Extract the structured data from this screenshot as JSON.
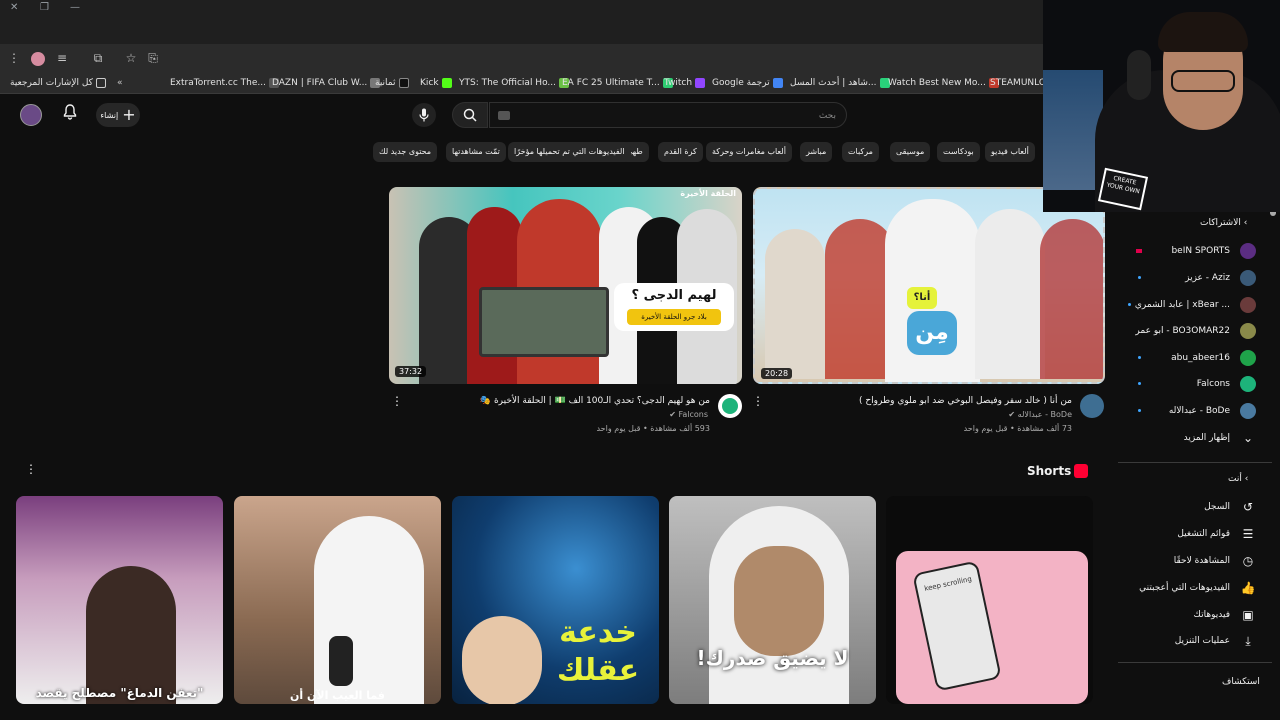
{
  "browser": {
    "bookmarks": [
      {
        "label": "كل الإشارات المرجعية",
        "icon": "folder-icon"
      },
      {
        "label": "ExtraTorrent.cc The...",
        "icon": "site-icon"
      },
      {
        "label": "DAZN | FIFA Club W...",
        "icon": "site-icon"
      },
      {
        "label": "ثمانية",
        "icon": "site-icon"
      },
      {
        "label": "Kick",
        "icon": "site-icon"
      },
      {
        "label": "YTS: The Official Ho...",
        "icon": "site-icon"
      },
      {
        "label": "EA FC 25 Ultimate T...",
        "icon": "site-icon"
      },
      {
        "label": "Twitch",
        "icon": "site-icon"
      },
      {
        "label": "Google ترجمة",
        "icon": "site-icon"
      },
      {
        "label": "شاهد | أحدث المسل...",
        "icon": "site-icon"
      },
      {
        "label": "Watch Best New Mo...",
        "icon": "site-icon"
      },
      {
        "label": "STEAMUNLOCK",
        "icon": "site-icon"
      }
    ],
    "more_bookmarks": "«"
  },
  "header": {
    "search_placeholder": "بحث",
    "create_label": "إنشاء"
  },
  "chips": [
    "ألعاب فيديو",
    "بودكاست",
    "موسيقى",
    "مركبات",
    "مباشر",
    "ألعاب مغامرات وحركة",
    "كرة القدم",
    "طهي",
    "الفيديوهات التي تم تحميلها مؤخرًا",
    "تمّت مشاهدتها",
    "محتوى جديد لك"
  ],
  "videos": [
    {
      "title": "من أنا ( خالد سفر وفيصل البوخي ضد ابو ملوي وطرواح )",
      "channel": "BoDe - عبدالاله",
      "meta": "73 ألف مشاهدة • قبل يوم واحد",
      "duration": "20:28",
      "thumb_text": "مِن",
      "thumb_badge": "أنا؟"
    },
    {
      "title": "من هو لهيم الدجى؟ تحدي الـ100 الف 💵 | الحلقة الأخيرة 🎭",
      "channel": "Falcons",
      "meta": "593 ألف مشاهدة • قبل يوم واحد",
      "duration": "37:32",
      "thumb_text": "لهيم الدجى ؟",
      "thumb_sub": "بلاد جرو الحلقة الأخيرة",
      "thumb_badge": "الحلقة الأخيرة"
    }
  ],
  "shorts": {
    "title": "Shorts",
    "items": [
      {
        "caption": "\"تعفن الدماغ\" مصطلح يقصد"
      },
      {
        "caption": "فما العيب الآن أن"
      },
      {
        "caption": "خدعة عقلك"
      },
      {
        "caption": "لا يضيق صدرك!"
      },
      {
        "caption": "keep scrolling"
      }
    ]
  },
  "sidebar": {
    "subscriptions_title": "الاشتراكات",
    "subscriptions": [
      {
        "name": "beIN SPORTS",
        "color": "#5b2d82"
      },
      {
        "name": "عزيز - Aziz",
        "color": "#3a5a78"
      },
      {
        "name": "عابد الشمري | xBear ...",
        "color": "#6a3b3b"
      },
      {
        "name": "ابو عمر - BO3OMAR22",
        "color": "#8a8a4a"
      },
      {
        "name": "abu_abeer16",
        "color": "#1fa34a"
      },
      {
        "name": "Falcons",
        "color": "#1db37a"
      },
      {
        "name": "عبدالاله - BoDe",
        "color": "#4a7aa0"
      }
    ],
    "show_more": "إظهار المزيد",
    "you_title": "أنت",
    "you_items": [
      {
        "label": "السجل",
        "icon": "history-icon"
      },
      {
        "label": "قوائم التشغيل",
        "icon": "playlists-icon"
      },
      {
        "label": "المشاهدة لاحقًا",
        "icon": "watch-later-icon"
      },
      {
        "label": "الفيديوهات التي أعجبتني",
        "icon": "like-icon"
      },
      {
        "label": "فيديوهاتك",
        "icon": "your-videos-icon"
      },
      {
        "label": "عمليات التنزيل",
        "icon": "download-icon"
      }
    ],
    "explore_title": "استكشاف"
  },
  "webcam": {
    "shirt_text": "CREATE YOUR OWN"
  },
  "colors": {
    "bg": "#0f0f0f",
    "chip": "#272727",
    "accent": "#ff0033",
    "link": "#3ea6ff"
  }
}
